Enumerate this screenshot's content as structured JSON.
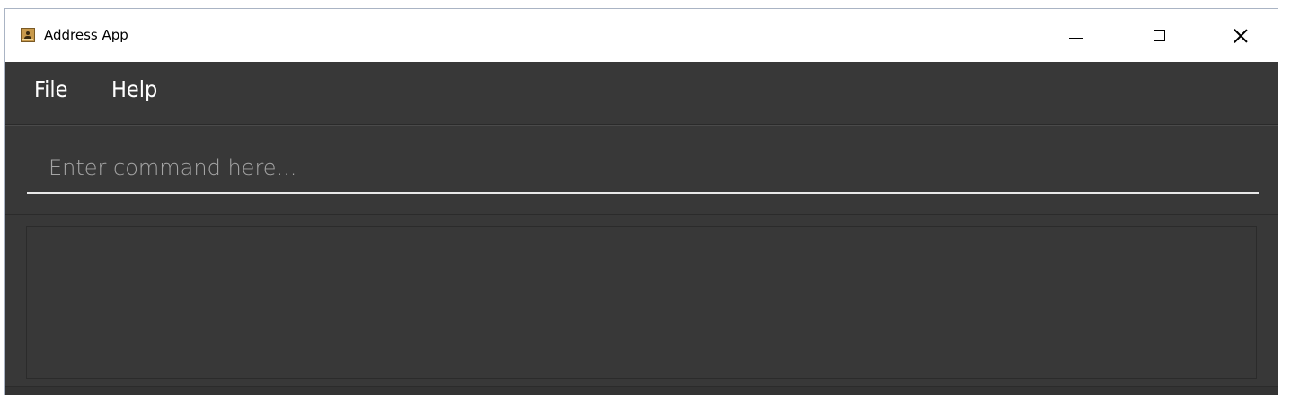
{
  "window": {
    "title": "Address App",
    "controls": {
      "minimize_icon": "minimize-icon",
      "maximize_icon": "maximize-icon",
      "close_icon": "close-icon"
    }
  },
  "menubar": {
    "items": [
      {
        "label": "File"
      },
      {
        "label": "Help"
      }
    ]
  },
  "command": {
    "value": "",
    "placeholder": "Enter command here..."
  },
  "result": {
    "text": ""
  },
  "colors": {
    "background": "#383838",
    "titlebar": "#ffffff",
    "text": "#ffffff",
    "placeholder": "#a5a5a5",
    "input_underline": "#e8e8e8"
  }
}
